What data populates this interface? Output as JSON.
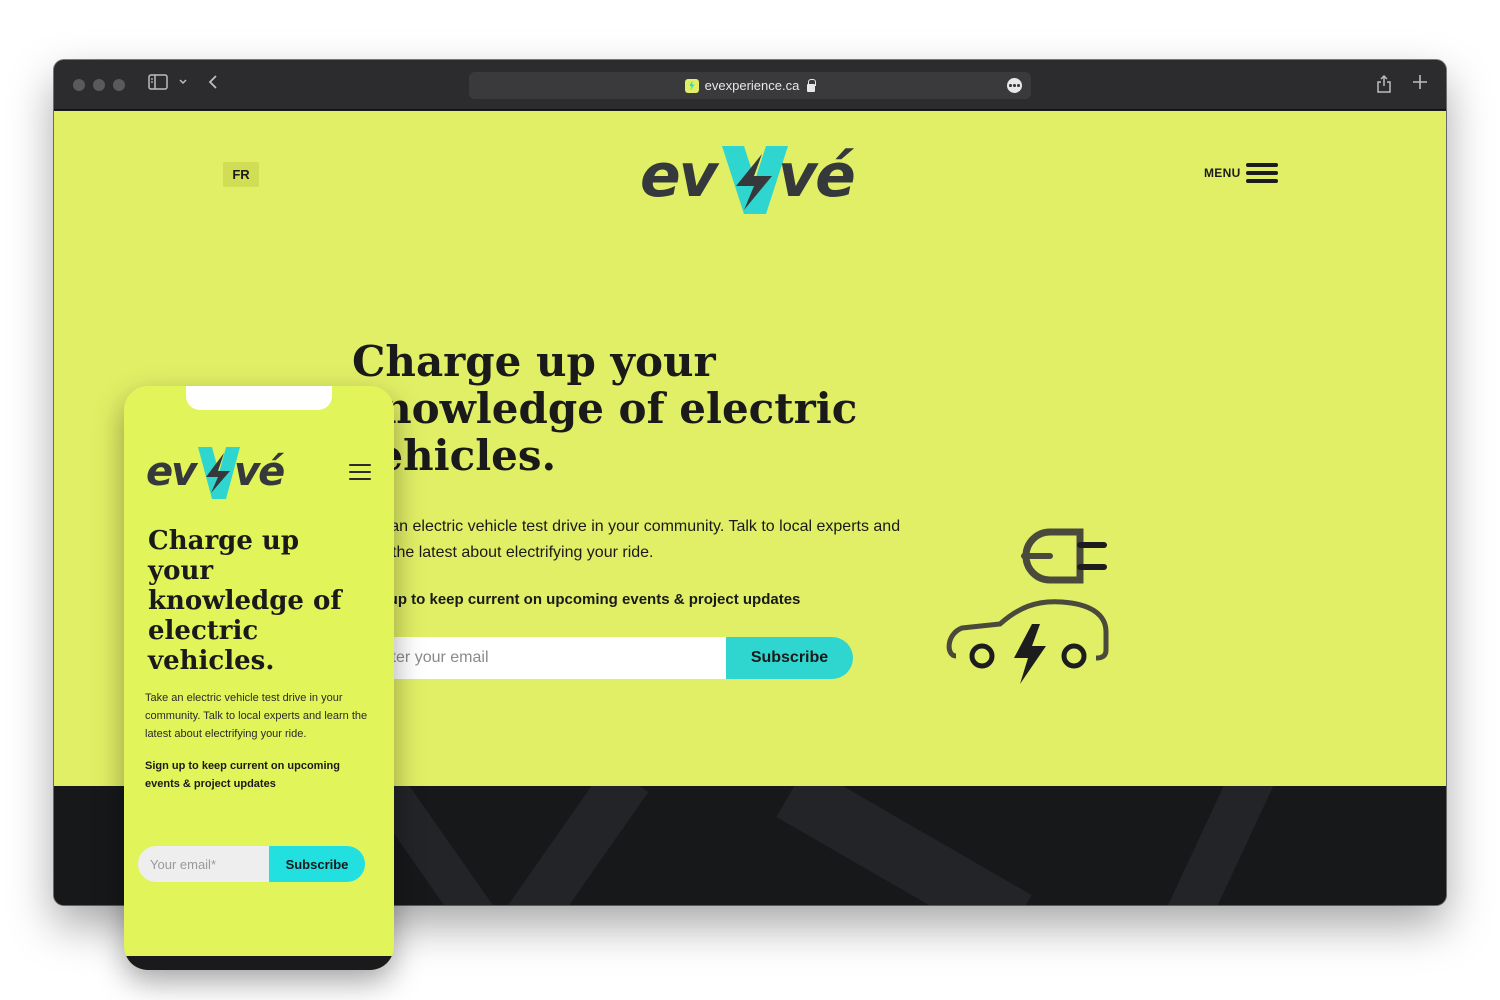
{
  "browser": {
    "url": "evexperience.ca",
    "icons": [
      "sidebar-icon",
      "chevron-down-icon",
      "back-arrow-icon",
      "lock-icon",
      "more-icon",
      "share-icon",
      "new-tab-icon"
    ]
  },
  "site": {
    "logo_text": "evxvé",
    "lang_button": "FR",
    "menu_label": "MENU",
    "headline": "Charge up your knowledge of electric vehicles.",
    "intro": "Take an electric vehicle test drive in your community. Talk to local experts and learn the latest about electrifying your ride.",
    "signup_text": "Sign up to keep current on upcoming events & project updates",
    "email_placeholder": "Enter your email",
    "subscribe_label": "Subscribe"
  },
  "mobile": {
    "logo_text": "evxvé",
    "headline": "Charge up your knowledge of electric vehicles.",
    "intro": "Take an electric vehicle test drive in your community. Talk to local experts and learn the latest about electrifying your ride.",
    "signup_text": "Sign up to keep current on upcoming events & project updates",
    "email_placeholder": "Your email*",
    "subscribe_label": "Subscribe"
  },
  "colors": {
    "hero_bg": "#e1ef66",
    "accent": "#2fd6cf",
    "dark": "#17181a",
    "text": "#1a1a1a"
  }
}
